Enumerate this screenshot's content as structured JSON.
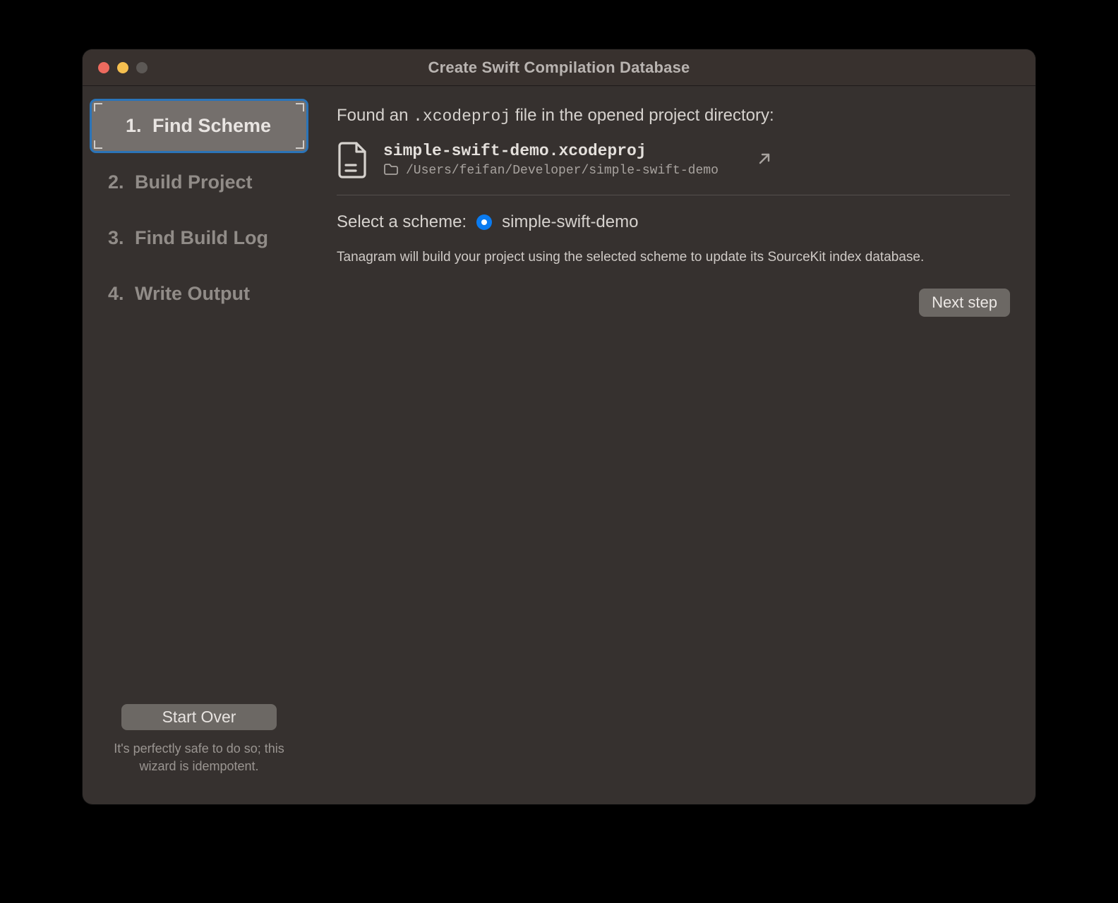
{
  "window": {
    "title": "Create Swift Compilation Database"
  },
  "sidebar": {
    "steps": [
      {
        "num": "1.",
        "label": "Find Scheme"
      },
      {
        "num": "2.",
        "label": "Build Project"
      },
      {
        "num": "3.",
        "label": "Find Build Log"
      },
      {
        "num": "4.",
        "label": "Write Output"
      }
    ],
    "start_over_label": "Start Over",
    "idempotent_note": "It's perfectly safe to do so; this wizard is idempotent."
  },
  "main": {
    "found_prefix": "Found an ",
    "found_code": ".xcodeproj",
    "found_suffix": " file in the opened project directory:",
    "project": {
      "name": "simple-swift-demo.xcodeproj",
      "path": "/Users/feifan/Developer/simple-swift-demo"
    },
    "scheme_prompt": "Select a scheme:",
    "scheme_selected": "simple-swift-demo",
    "explain": "Tanagram will build your project using the selected scheme to update its SourceKit index database.",
    "next_label": "Next step"
  },
  "icons": {
    "file": "file-icon",
    "folder": "folder-icon",
    "open_arrow": "arrow-upright-icon"
  },
  "colors": {
    "accent": "#0a7bf0",
    "selection_border": "#2b74b8",
    "window_bg": "#36312f",
    "button_bg": "#6c6864"
  }
}
